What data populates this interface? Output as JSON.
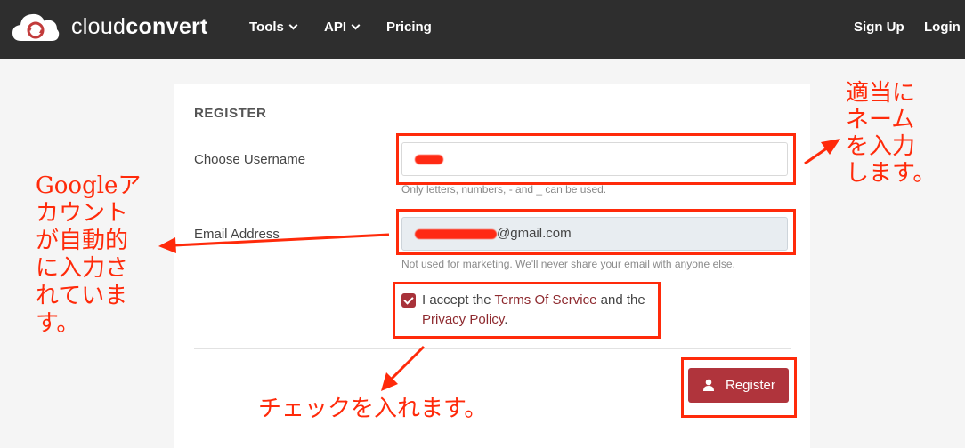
{
  "nav": {
    "brand_light": "cloud",
    "brand_bold": "convert",
    "tools_label": "Tools",
    "api_label": "API",
    "pricing_label": "Pricing",
    "signup_label": "Sign Up",
    "login_label": "Login"
  },
  "form": {
    "heading": "REGISTER",
    "username_label": "Choose Username",
    "username_help": "Only letters, numbers, - and _ can be used.",
    "email_label": "Email Address",
    "email_domain": "@gmail.com",
    "email_help": "Not used for marketing. We'll never share your email with anyone else.",
    "terms_prefix": "I accept the ",
    "terms_link": "Terms Of Service",
    "terms_middle": " and the",
    "privacy_link": "Privacy Policy",
    "terms_suffix": ".",
    "register_label": "Register"
  },
  "annotations": {
    "right_lines": [
      "適当に",
      "ネーム",
      "を入力",
      "します。"
    ],
    "left_lines": [
      "Googleア",
      "カウント",
      "が自動的",
      "に入力さ",
      "れていま",
      "す。"
    ],
    "bottom": "チェックを入れます。"
  },
  "colors": {
    "navbar": "#2e2e2e",
    "accent": "#b0343c",
    "annotation_red": "#ff2a0a"
  }
}
